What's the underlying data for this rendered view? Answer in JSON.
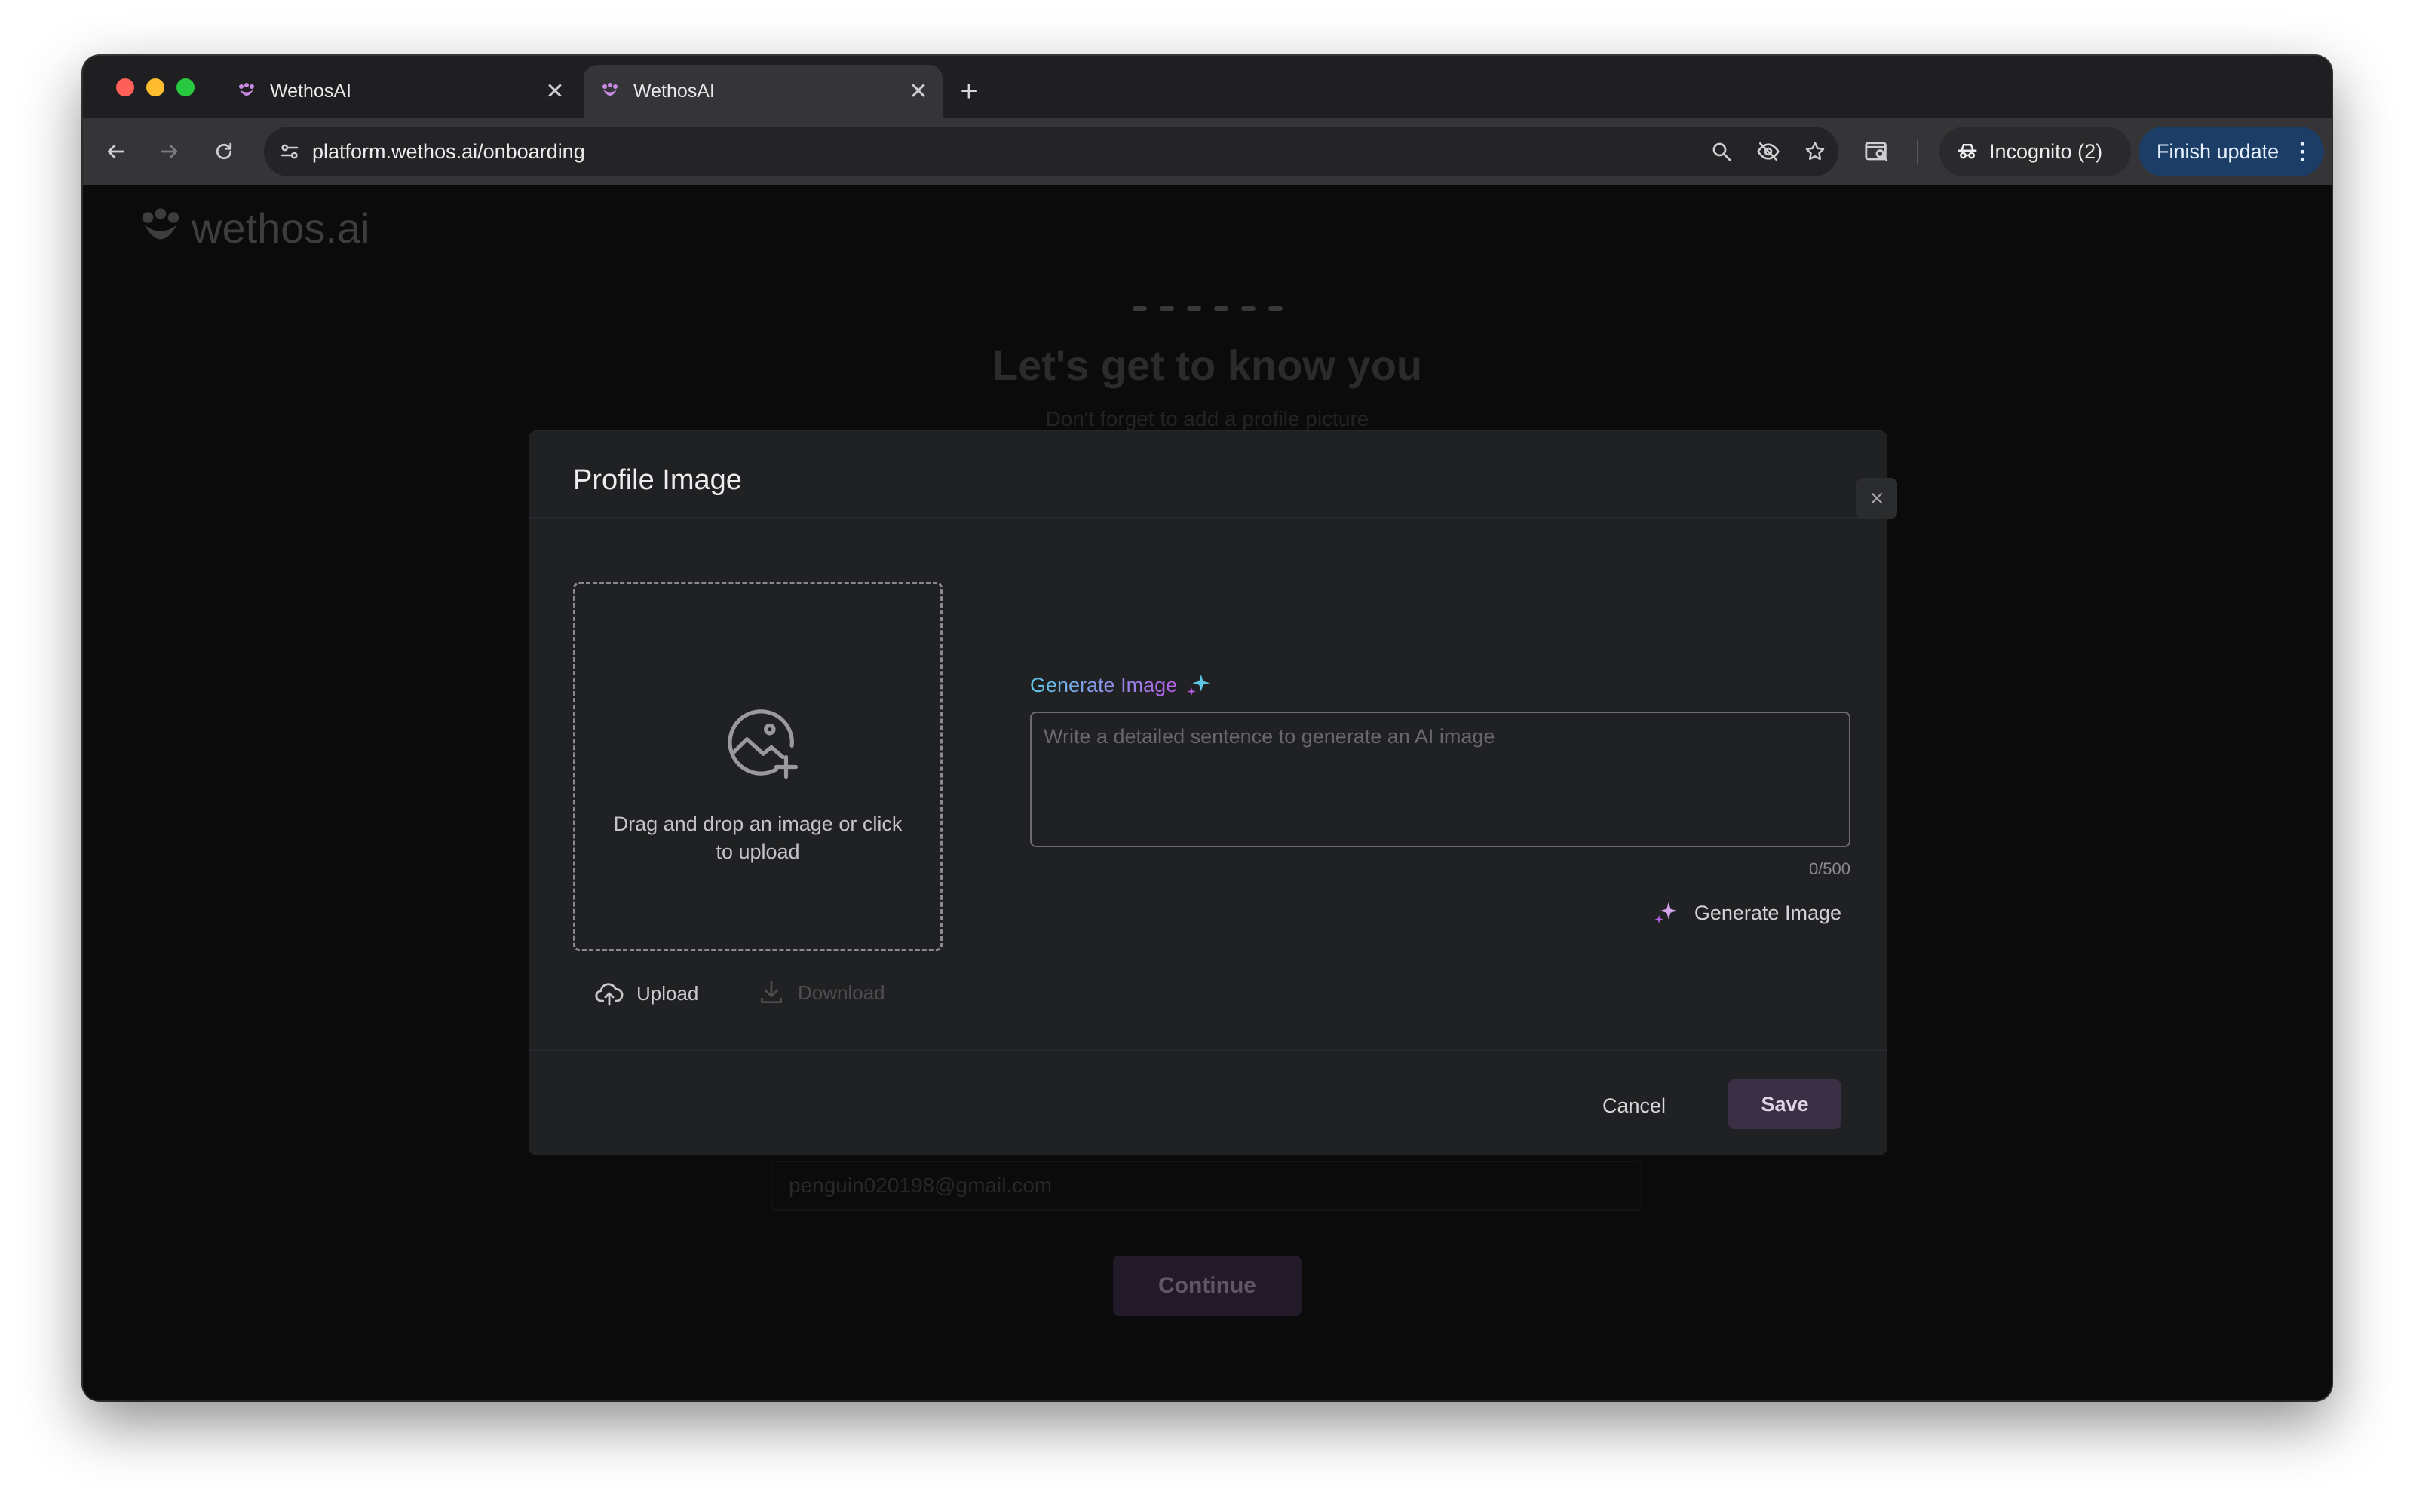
{
  "browser": {
    "tabs": [
      {
        "title": "WethosAI",
        "active": false
      },
      {
        "title": "WethosAI",
        "active": true
      }
    ],
    "new_tab_symbol": "+",
    "tab_close_symbol": "✕",
    "url": "platform.wethos.ai/onboarding",
    "incognito_label": "Incognito (2)",
    "finish_update_label": "Finish update",
    "finish_update_menu": "⋮"
  },
  "page": {
    "logo_text": "wethos.ai",
    "step_count": 6,
    "headline": "Let's get to know you",
    "subheadline": "Don't forget to add a profile picture",
    "email_value": "penguin020198@gmail.com",
    "continue_label": "Continue"
  },
  "modal": {
    "title": "Profile Image",
    "dropzone_text": "Drag and drop an image or click to upload",
    "upload_label": "Upload",
    "download_label": "Download",
    "generate_label": "Generate Image",
    "prompt_placeholder": "Write a detailed sentence to generate an AI image",
    "prompt_value": "",
    "char_counter": "0/500",
    "generate_button_label": "Generate Image",
    "cancel_label": "Cancel",
    "save_label": "Save"
  },
  "colors": {
    "accent_gradient_start": "#5ec8e6",
    "accent_gradient_end": "#b45de6",
    "save_button_bg": "#3b2f45",
    "finish_update_bg": "#1b3d66"
  },
  "icons": {
    "tab_favicon": "wethos-logo-icon",
    "back": "arrow-left-icon",
    "forward": "arrow-right-icon",
    "reload": "reload-icon",
    "site_info": "tune-icon",
    "zoom": "magnifier-icon",
    "tracking": "eye-off-icon",
    "bookmark": "star-icon",
    "side_panel": "side-panel-search-icon",
    "incognito": "incognito-icon",
    "dropzone": "image-add-icon",
    "upload": "cloud-upload-icon",
    "download": "download-icon",
    "sparkle": "sparkle-icon",
    "close": "close-icon"
  }
}
